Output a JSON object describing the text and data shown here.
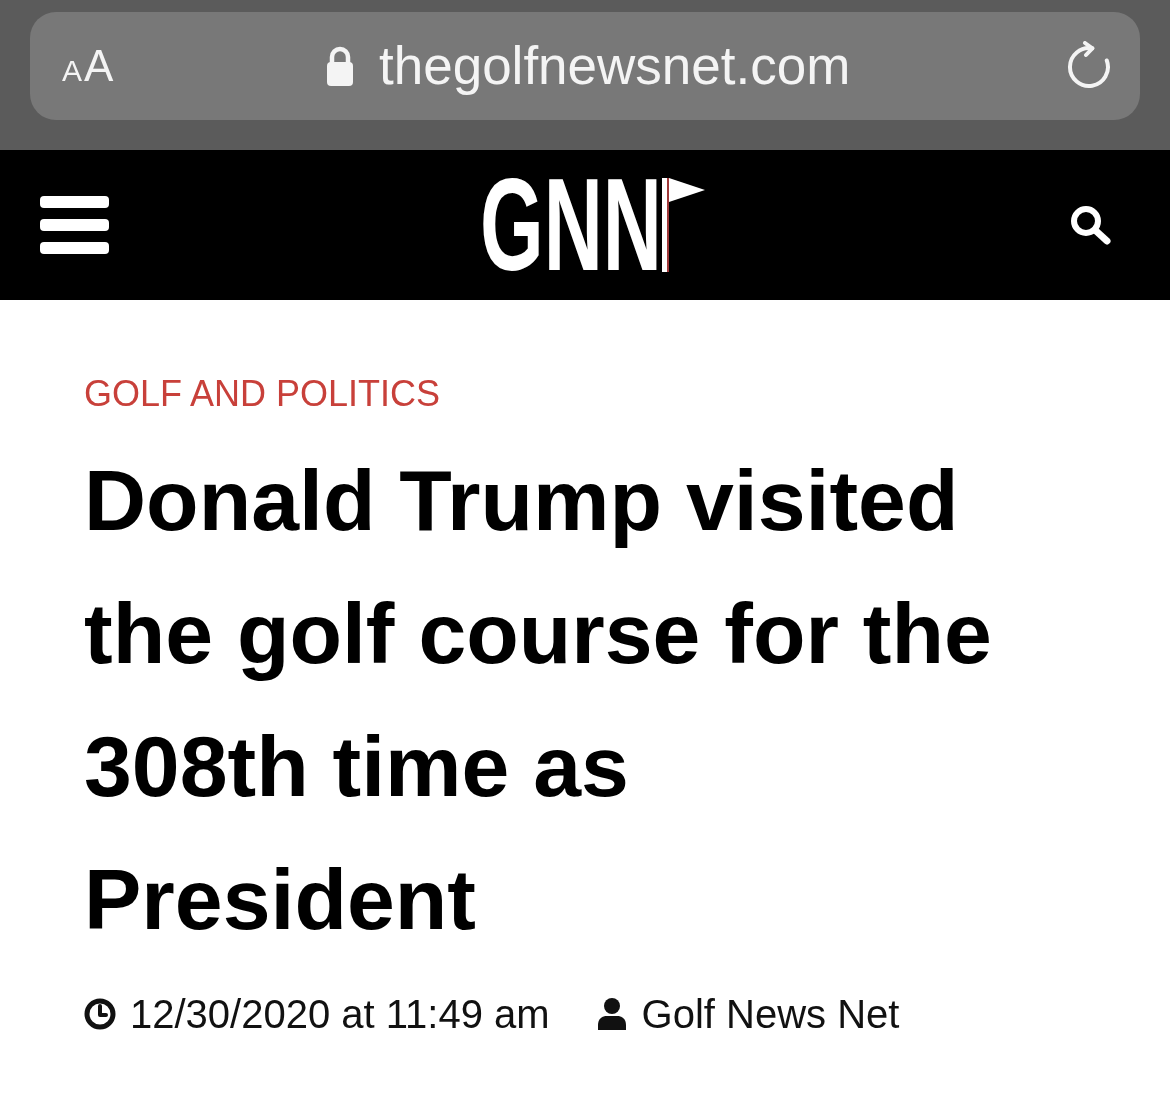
{
  "browser": {
    "reader_label": "AA",
    "secure": true,
    "address": "thegolfnewsnet.com"
  },
  "nav": {
    "logo": "GNN"
  },
  "article": {
    "category": "GOLF AND POLITICS",
    "headline": "Donald Trump visited the golf course for the 308th time as President",
    "date": "12/30/2020 at 11:49 am",
    "author": "Golf News Net"
  }
}
